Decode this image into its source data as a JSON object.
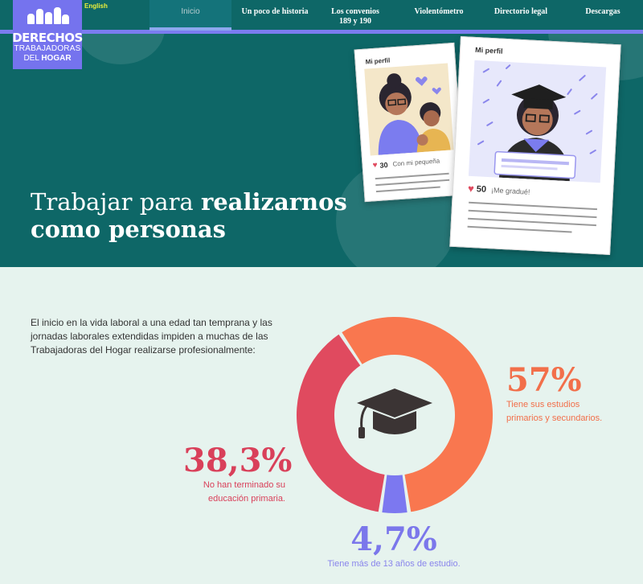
{
  "logo": {
    "line1": "DERECHOS",
    "line2": "TRABAJADORAS",
    "line3_a": "DEL ",
    "line3_b": "HOGAR"
  },
  "language_link": "English",
  "nav": [
    {
      "label": "Inicio",
      "active": true
    },
    {
      "label": "Un poco de historia"
    },
    {
      "label": "Los convenios",
      "label2": "189 y 190"
    },
    {
      "label": "Violentómetro"
    },
    {
      "label": "Directorio legal"
    },
    {
      "label": "Descargas"
    }
  ],
  "hero": {
    "title_normal": "Trabajar para ",
    "title_bold": "realizarnos",
    "title_line2": "como personas"
  },
  "phones": [
    {
      "label": "Mi perfil",
      "likes": "30",
      "caption": "Con mi pequeña"
    },
    {
      "label": "Mi perfil",
      "likes": "50",
      "caption": "¡Me gradué!"
    }
  ],
  "intro": "El inicio en la vida laboral a una edad tan temprana y las jornadas laborales extendidas impiden a muchas de las Trabajadoras del Hogar realizarse profesionalmente:",
  "chart_data": {
    "type": "pie",
    "donut": true,
    "slices": [
      {
        "label": "Tiene sus estudios primarios y secundarios.",
        "display": "57%",
        "value": 57,
        "color": "#f9774f"
      },
      {
        "label": "Tiene más de 13 años de estudio.",
        "display": "4,7%",
        "value": 4.7,
        "color": "#7c78f0"
      },
      {
        "label": "No han terminado su educación primaria.",
        "display": "38,3%",
        "value": 38.3,
        "color": "#e04a5f"
      }
    ]
  },
  "stats": {
    "s57": {
      "num": "57%",
      "line1": "Tiene sus estudios",
      "line2": "primarios y secundarios."
    },
    "s383": {
      "num": "38,3%",
      "line1": "No han terminado su",
      "line2": "educación primaria."
    },
    "s47": {
      "num": "4,7%",
      "line1": "Tiene más de 13 años de estudio."
    }
  },
  "icons": {
    "graduation": "graduation-cap-icon",
    "heart": "heart-icon"
  }
}
